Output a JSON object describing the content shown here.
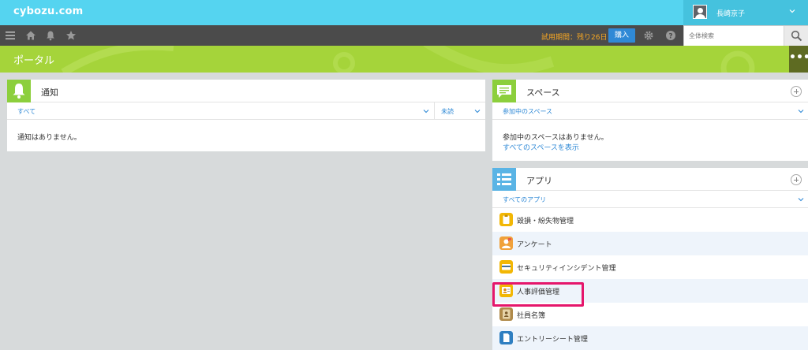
{
  "app": {
    "logo": "cybozu.com"
  },
  "user": {
    "name": "長崎京子"
  },
  "nav": {
    "trial_text": "試用期間：残り26日",
    "buy_label": "購入"
  },
  "search": {
    "placeholder": "全体検索"
  },
  "portal": {
    "title": "ポータル",
    "more": "•••"
  },
  "notifications": {
    "title": "通知",
    "filter_all": "すべて",
    "filter_unread": "未読",
    "empty": "通知はありません。"
  },
  "spaces": {
    "title": "スペース",
    "filter": "参加中のスペース",
    "empty": "参加中のスペースはありません。",
    "show_all": "すべてのスペースを表示"
  },
  "apps": {
    "title": "アプリ",
    "filter": "すべてのアプリ",
    "items": [
      {
        "label": "毀損・紛失物管理",
        "icon": "clipboard-icon",
        "color": "#f2b705"
      },
      {
        "label": "アンケート",
        "icon": "survey-icon",
        "color": "#f0a13a"
      },
      {
        "label": "セキュリティインシデント管理",
        "icon": "card-icon",
        "color": "#f2b705"
      },
      {
        "label": "人事評価管理",
        "icon": "evaluation-icon",
        "color": "#f2b705"
      },
      {
        "label": "社員名簿",
        "icon": "address-book-icon",
        "color": "#b08a4a"
      },
      {
        "label": "エントリーシート管理",
        "icon": "document-icon",
        "color": "#2f7fc1"
      }
    ]
  },
  "colors": {
    "header": "#55d4f0",
    "nav": "#4b4b4b",
    "portal": "#a5d43a",
    "link": "#2f89d6",
    "highlight": "#e5166b"
  }
}
